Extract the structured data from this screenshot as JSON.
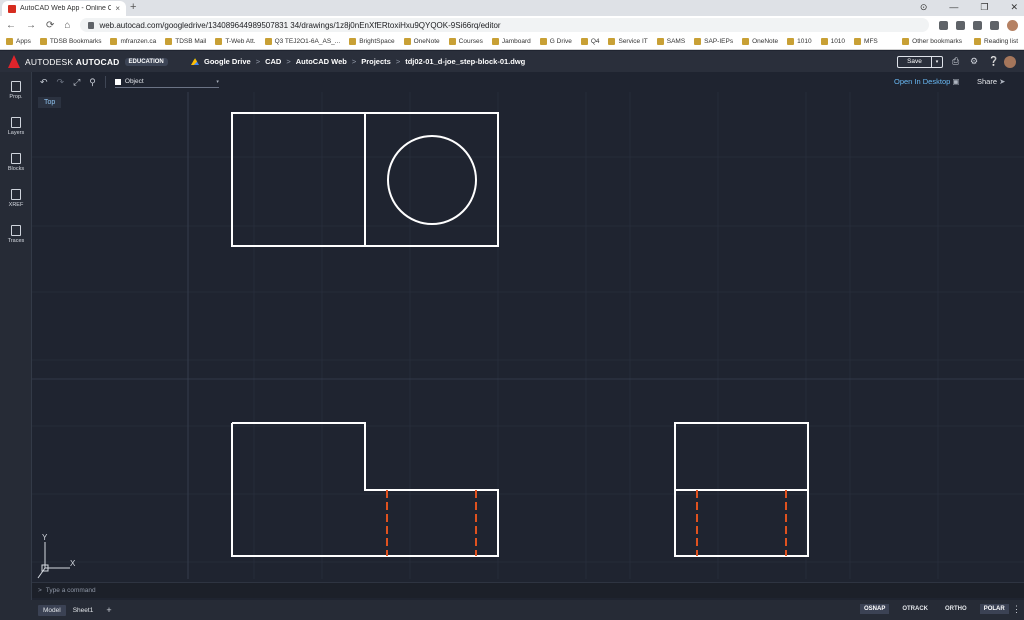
{
  "browser": {
    "tab_title": "AutoCAD Web App - Online CAD",
    "tab_close": "×",
    "new_tab": "+",
    "window_controls": [
      "⊙",
      "—",
      "❐",
      "✕"
    ],
    "url": "web.autocad.com/googledrive/134089644989507831 34/drawings/1z8j0nEnXfERtoxiHxu9QYQOK-9Si66rq/editor",
    "nav": [
      "←",
      "→",
      "⟳",
      "⌂"
    ],
    "bookmarks": [
      "Apps",
      "TDSB Bookmarks",
      "mfranzen.ca",
      "TDSB Mail",
      "T-Web Att.",
      "Q3 TEJ2O1-6A_AS_...",
      "BrightSpace",
      "OneNote",
      "Courses",
      "Jamboard",
      "G Drive",
      "Q4",
      "Service IT",
      "SAMS",
      "SAP-IEPs",
      "OneNote",
      "1010",
      "1010",
      "MFS"
    ],
    "bookmarks_right": [
      "Other bookmarks",
      "Reading list"
    ]
  },
  "app": {
    "brand_prefix": "AUTODESK",
    "brand_name": "AUTOCAD",
    "edition_badge": "EDUCATION",
    "breadcrumbs": [
      "Google Drive",
      "CAD",
      "AutoCAD Web",
      "Projects",
      "tdj02-01_d-joe_step-block-01.dwg"
    ],
    "breadcrumb_sep": ">",
    "save_label": "Save",
    "save_drop": "▾",
    "open_desktop_label": "Open In Desktop",
    "share_label": "Share",
    "layer_value": "Object",
    "layer_chevron": "▾",
    "view_label": "Top",
    "command_placeholder": "Type a command",
    "command_prompt": ">"
  },
  "sidebar": {
    "items": [
      "Prop.",
      "Layers",
      "Blocks",
      "XREF",
      "Traces"
    ]
  },
  "status": {
    "layout_tabs": [
      "Model",
      "Sheet1"
    ],
    "add_tab": "+",
    "toggles": [
      {
        "label": "OSNAP",
        "on": true
      },
      {
        "label": "OTRACK",
        "on": false
      },
      {
        "label": "ORTHO",
        "on": false
      },
      {
        "label": "POLAR",
        "on": true
      }
    ],
    "more": "⋮"
  },
  "ucs": {
    "x_label": "X",
    "y_label": "Y"
  },
  "colors": {
    "canvas_bg": "#1f2430",
    "object_lines": "#ffffff",
    "hidden_lines": "#e0521f",
    "accent": "#68b8f3",
    "autodesk_red": "#e0242b"
  }
}
